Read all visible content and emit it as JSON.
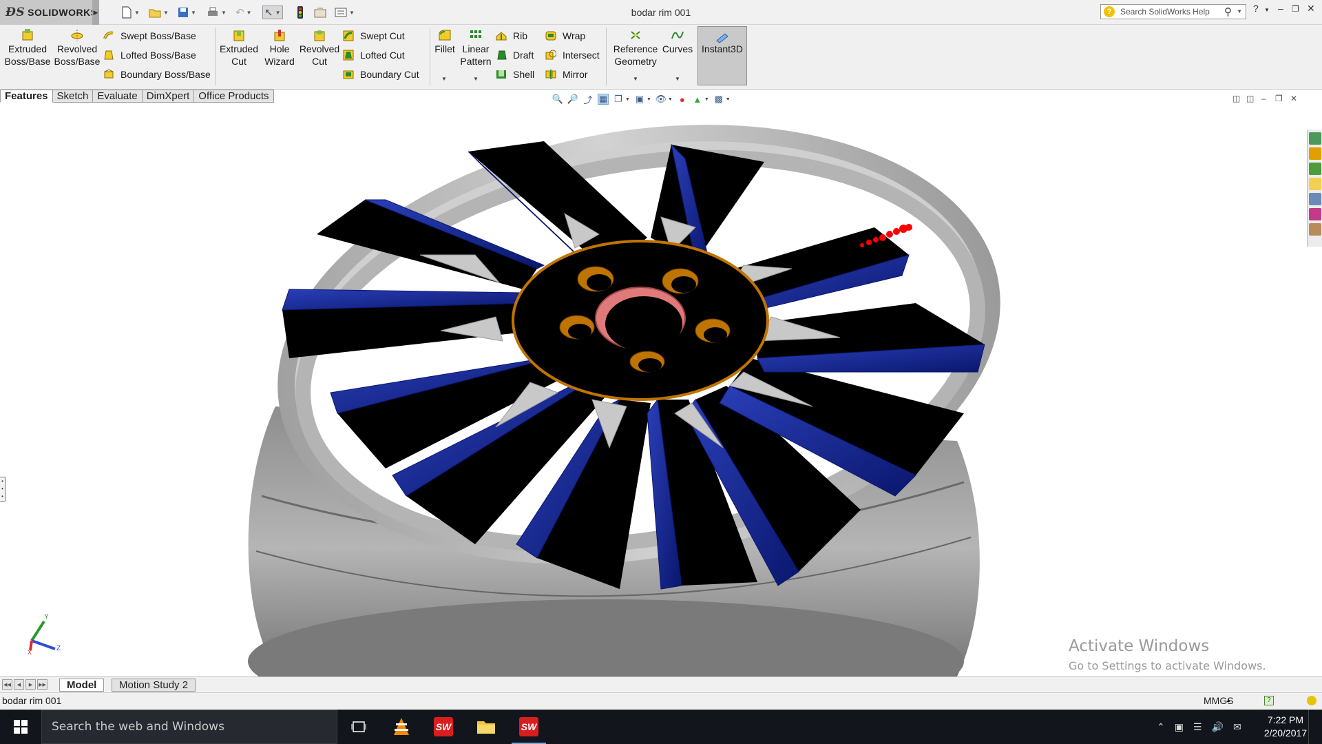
{
  "app": {
    "brand": "SOLIDWORKS",
    "document_title": "bodar rim 001",
    "search_placeholder": "Search SolidWorks Help"
  },
  "command_manager": {
    "large_buttons": [
      {
        "id": "extruded-boss",
        "label1": "Extruded",
        "label2": "Boss/Base",
        "icon": "extruded-boss-icon"
      },
      {
        "id": "revolved-boss",
        "label1": "Revolved",
        "label2": "Boss/Base",
        "icon": "revolved-boss-icon"
      },
      {
        "id": "extruded-cut",
        "label1": "Extruded",
        "label2": "Cut",
        "icon": "extruded-cut-icon"
      },
      {
        "id": "hole-wizard",
        "label1": "Hole",
        "label2": "Wizard",
        "icon": "hole-wizard-icon"
      },
      {
        "id": "revolved-cut",
        "label1": "Revolved",
        "label2": "Cut",
        "icon": "revolved-cut-icon"
      },
      {
        "id": "fillet",
        "label1": "Fillet",
        "label2": "",
        "icon": "fillet-icon"
      },
      {
        "id": "linear-pattern",
        "label1": "Linear",
        "label2": "Pattern",
        "icon": "linear-pattern-icon"
      },
      {
        "id": "reference-geometry",
        "label1": "Reference",
        "label2": "Geometry",
        "icon": "reference-geometry-icon"
      },
      {
        "id": "curves",
        "label1": "Curves",
        "label2": "",
        "icon": "curves-icon"
      }
    ],
    "boss_small": [
      "Swept Boss/Base",
      "Lofted Boss/Base",
      "Boundary Boss/Base"
    ],
    "cut_small": [
      "Swept Cut",
      "Lofted Cut",
      "Boundary Cut"
    ],
    "feature_small_1": [
      "Rib",
      "Draft",
      "Shell"
    ],
    "feature_small_2": [
      "Wrap",
      "Intersect",
      "Mirror"
    ],
    "instant3d": "Instant3D"
  },
  "tabs": [
    "Features",
    "Sketch",
    "Evaluate",
    "DimXpert",
    "Office Products"
  ],
  "active_tab": "Features",
  "viewport": {
    "triad_labels": {
      "y": "Y",
      "x": "X",
      "z": "Z"
    }
  },
  "activation": {
    "title": "Activate Windows",
    "subtitle": "Go to Settings to activate Windows."
  },
  "model_tabs": [
    "Model",
    "Motion Study 2"
  ],
  "status_bar": {
    "document": "bodar rim 001",
    "units": "MMGS"
  },
  "taskbar": {
    "search_text": "Search the web and Windows",
    "time": "7:22 PM",
    "date": "2/20/2017"
  },
  "colors": {
    "spoke_blue": "#0e1f8c",
    "spoke_black": "#000000",
    "rim_gray": "#a9a9a9",
    "bolt_orange": "#c07400",
    "center_pink": "#e07a7a"
  }
}
